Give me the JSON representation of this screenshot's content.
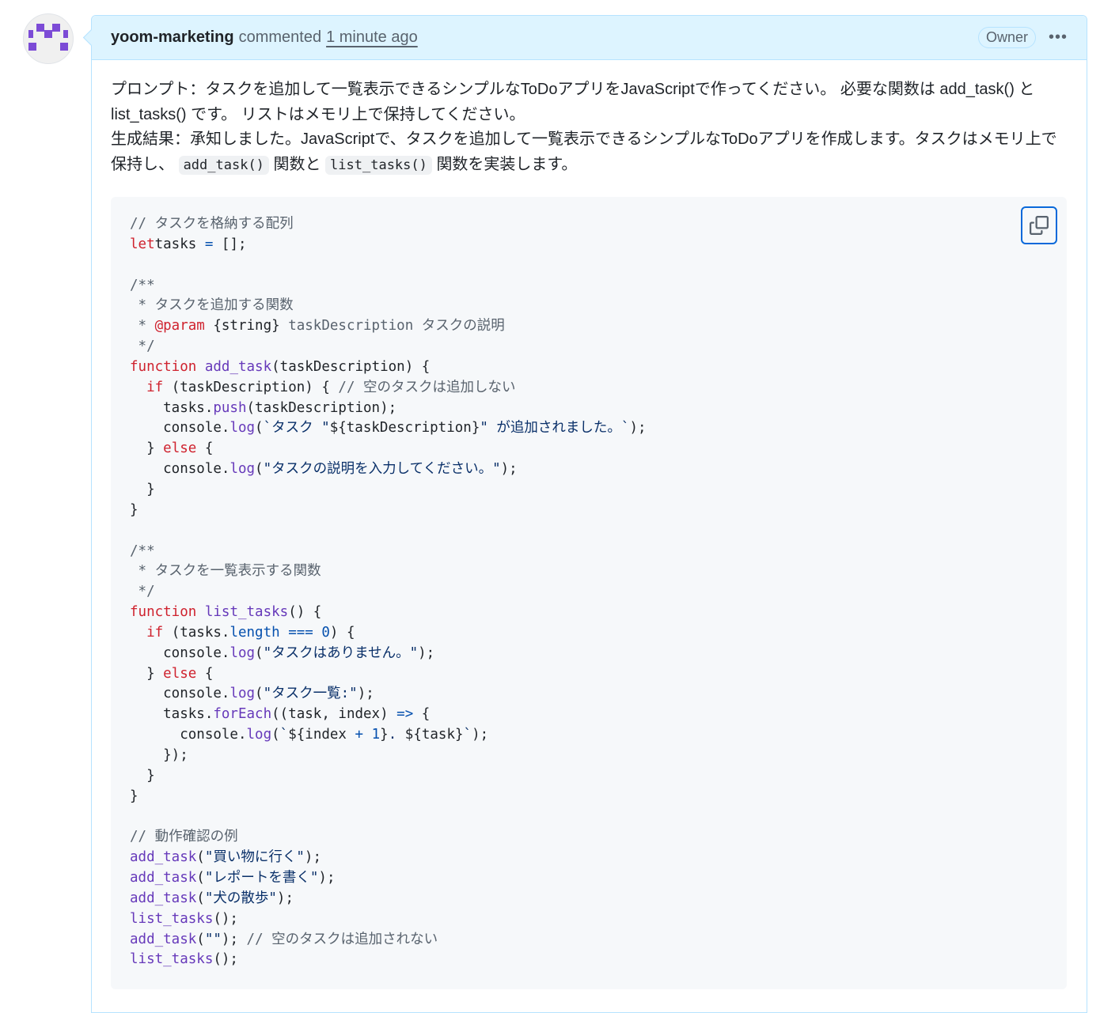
{
  "comment": {
    "author": "yoom-marketing",
    "action": "commented",
    "time": "1 minute ago",
    "badge": "Owner",
    "menu_icon": "kebab-horizontal-icon",
    "paragraph1": "プロンプト：タスクを追加して一覧表示できるシンプルなToDoアプリをJavaScriptで作ってください。 必要な関数は add_task() と list_tasks() です。 リストはメモリ上で保持してください。",
    "paragraph2_before": "生成結果：承知しました。JavaScriptで、タスクを追加して一覧表示できるシンプルなToDoアプリを作成します。タスクはメモリ上で保持し、",
    "inline_code1": "add_task()",
    "paragraph2_middle": "関数と",
    "inline_code2": "list_tasks()",
    "paragraph2_after": "関数を実装します。"
  },
  "code": {
    "copy_icon": "copy-icon",
    "colors": {
      "keyword": "#cf222e",
      "function": "#6639ba",
      "string": "#0a3069",
      "comment": "#59636e",
      "constant": "#0550ae"
    },
    "lines": [
      [
        [
          "c",
          "// タスクを格納する配列"
        ]
      ],
      [
        [
          "k",
          "let"
        ],
        [
          "",
          "tasks "
        ],
        [
          "n",
          "="
        ],
        [
          "",
          " [];"
        ]
      ],
      [],
      [
        [
          "c",
          "/**"
        ]
      ],
      [
        [
          "c",
          " * タスクを追加する関数"
        ]
      ],
      [
        [
          "c",
          " * "
        ],
        [
          "k",
          "@param"
        ],
        [
          "",
          " {string}"
        ],
        [
          "c",
          " taskDescription タスクの説明"
        ]
      ],
      [
        [
          "c",
          " */"
        ]
      ],
      [
        [
          "k",
          "function"
        ],
        [
          "",
          " "
        ],
        [
          "f",
          "add_task"
        ],
        [
          "",
          "(taskDescription) {"
        ]
      ],
      [
        [
          "",
          "  "
        ],
        [
          "k",
          "if"
        ],
        [
          "",
          " (taskDescription) { "
        ],
        [
          "c",
          "// 空のタスクは追加しない"
        ]
      ],
      [
        [
          "",
          "    tasks."
        ],
        [
          "f",
          "push"
        ],
        [
          "",
          "(taskDescription);"
        ]
      ],
      [
        [
          "",
          "    console."
        ],
        [
          "f",
          "log"
        ],
        [
          "",
          "("
        ],
        [
          "s",
          "`タスク \""
        ],
        [
          "",
          "${taskDescription}"
        ],
        [
          "s",
          "\" が追加されました。`"
        ],
        [
          "",
          ");"
        ]
      ],
      [
        [
          "",
          "  } "
        ],
        [
          "k",
          "else"
        ],
        [
          "",
          " {"
        ]
      ],
      [
        [
          "",
          "    console."
        ],
        [
          "f",
          "log"
        ],
        [
          "",
          "("
        ],
        [
          "s",
          "\"タスクの説明を入力してください。\""
        ],
        [
          "",
          ");"
        ]
      ],
      [
        [
          "",
          "  }"
        ]
      ],
      [
        [
          "",
          "}"
        ]
      ],
      [],
      [
        [
          "c",
          "/**"
        ]
      ],
      [
        [
          "c",
          " * タスクを一覧表示する関数"
        ]
      ],
      [
        [
          "c",
          " */"
        ]
      ],
      [
        [
          "k",
          "function"
        ],
        [
          "",
          " "
        ],
        [
          "f",
          "list_tasks"
        ],
        [
          "",
          "() {"
        ]
      ],
      [
        [
          "",
          "  "
        ],
        [
          "k",
          "if"
        ],
        [
          "",
          " (tasks."
        ],
        [
          "n",
          "length"
        ],
        [
          "",
          " "
        ],
        [
          "n",
          "==="
        ],
        [
          "",
          " "
        ],
        [
          "n",
          "0"
        ],
        [
          "",
          ") {"
        ]
      ],
      [
        [
          "",
          "    console."
        ],
        [
          "f",
          "log"
        ],
        [
          "",
          "("
        ],
        [
          "s",
          "\"タスクはありません。\""
        ],
        [
          "",
          ");"
        ]
      ],
      [
        [
          "",
          "  } "
        ],
        [
          "k",
          "else"
        ],
        [
          "",
          " {"
        ]
      ],
      [
        [
          "",
          "    console."
        ],
        [
          "f",
          "log"
        ],
        [
          "",
          "("
        ],
        [
          "s",
          "\"タスク一覧:\""
        ],
        [
          "",
          ");"
        ]
      ],
      [
        [
          "",
          "    tasks."
        ],
        [
          "f",
          "forEach"
        ],
        [
          "",
          "((task, index) "
        ],
        [
          "n",
          "=>"
        ],
        [
          "",
          " {"
        ]
      ],
      [
        [
          "",
          "      console."
        ],
        [
          "f",
          "log"
        ],
        [
          "",
          "("
        ],
        [
          "s",
          "`"
        ],
        [
          "",
          "${index "
        ],
        [
          "n",
          "+"
        ],
        [
          "",
          " "
        ],
        [
          "n",
          "1"
        ],
        [
          "",
          "}"
        ],
        [
          "s",
          ". "
        ],
        [
          "",
          "${task}"
        ],
        [
          "s",
          "`"
        ],
        [
          "",
          ");"
        ]
      ],
      [
        [
          "",
          "    });"
        ]
      ],
      [
        [
          "",
          "  }"
        ]
      ],
      [
        [
          "",
          "}"
        ]
      ],
      [],
      [
        [
          "c",
          "// 動作確認の例"
        ]
      ],
      [
        [
          "f",
          "add_task"
        ],
        [
          "",
          "("
        ],
        [
          "s",
          "\"買い物に行く\""
        ],
        [
          "",
          ");"
        ]
      ],
      [
        [
          "f",
          "add_task"
        ],
        [
          "",
          "("
        ],
        [
          "s",
          "\"レポートを書く\""
        ],
        [
          "",
          ");"
        ]
      ],
      [
        [
          "f",
          "add_task"
        ],
        [
          "",
          "("
        ],
        [
          "s",
          "\"犬の散歩\""
        ],
        [
          "",
          ");"
        ]
      ],
      [
        [
          "f",
          "list_tasks"
        ],
        [
          "",
          "();"
        ]
      ],
      [
        [
          "f",
          "add_task"
        ],
        [
          "",
          "("
        ],
        [
          "s",
          "\"\""
        ],
        [
          "",
          "); "
        ],
        [
          "c",
          "// 空のタスクは追加されない"
        ]
      ],
      [
        [
          "f",
          "list_tasks"
        ],
        [
          "",
          "();"
        ]
      ]
    ]
  }
}
